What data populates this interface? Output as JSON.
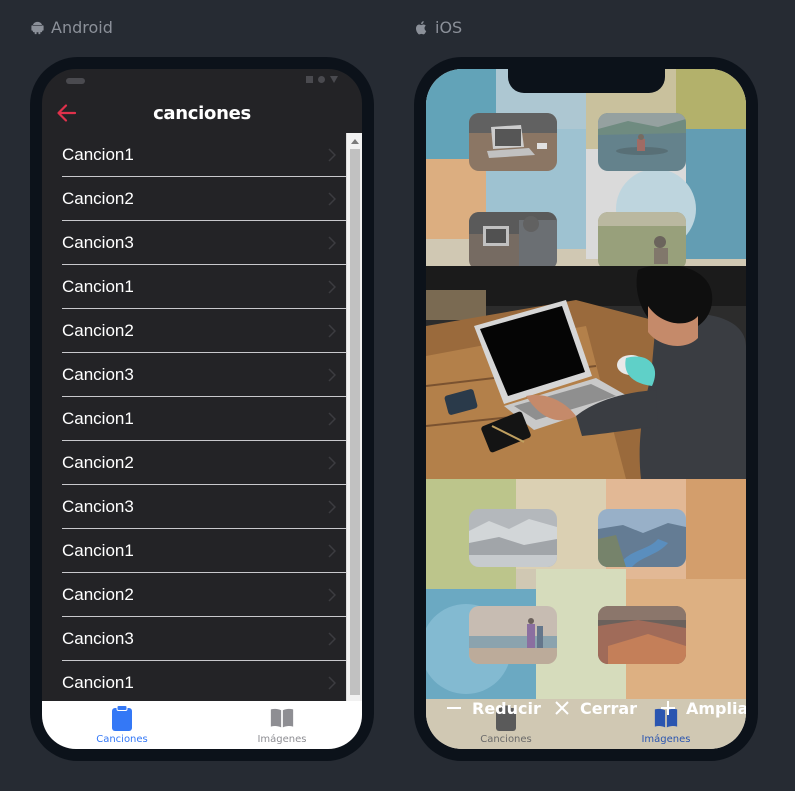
{
  "platforms": {
    "android": "Android",
    "ios": "iOS"
  },
  "android": {
    "title": "canciones",
    "songs": [
      "Cancion1",
      "Cancion2",
      "Cancion3",
      "Cancion1",
      "Cancion2",
      "Cancion3",
      "Cancion1",
      "Cancion2",
      "Cancion3",
      "Cancion1",
      "Cancion2",
      "Cancion3",
      "Cancion1"
    ],
    "tabs": [
      {
        "label": "Canciones",
        "icon": "clipboard-icon",
        "active": true
      },
      {
        "label": "Imágenes",
        "icon": "book-icon",
        "active": false
      }
    ]
  },
  "ios": {
    "zoom": {
      "reduce": "Reducir",
      "close": "Cerrar",
      "enlarge": "Ampliar"
    },
    "tabs": [
      {
        "label": "Canciones",
        "icon": "clipboard-icon",
        "active": false
      },
      {
        "label": "Imágenes",
        "icon": "book-icon",
        "active": true
      }
    ]
  },
  "colors": {
    "accent_blue": "#3478f6",
    "back_arrow": "#e0314b",
    "tab_inactive": "#8e8e93",
    "background": "#262b33"
  }
}
